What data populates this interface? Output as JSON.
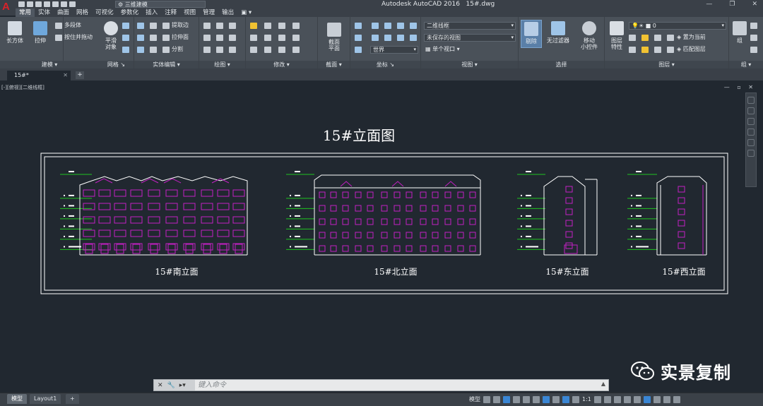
{
  "app": {
    "logo_letter": "A",
    "title": "Autodesk AutoCAD 2016",
    "filename": "15#.dwg",
    "workspace": "三维建模"
  },
  "window_controls": [
    "—",
    "❐",
    "✕"
  ],
  "ribbon_tabs": [
    "常用",
    "实体",
    "曲面",
    "网格",
    "可视化",
    "参数化",
    "插入",
    "注释",
    "视图",
    "管理",
    "输出"
  ],
  "ribbon_active_tab": 0,
  "panels": {
    "modeling": {
      "label": "建模",
      "box_label": "长方体",
      "extrude_label": "拉伸",
      "polysolid_label": "多段体",
      "presspull_label": "按住并拖动"
    },
    "mesh": {
      "label": "网格",
      "smooth_label_1": "平滑",
      "smooth_label_2": "对象"
    },
    "solid_edit": {
      "label": "实体编辑",
      "extract_edges": "提取边",
      "extrude_faces": "拉伸面",
      "separate": "分割"
    },
    "draw": {
      "label": "绘图"
    },
    "modify": {
      "label": "修改"
    },
    "section": {
      "label": "截面",
      "section_plane_1": "截面",
      "section_plane_2": "平面"
    },
    "coordinates": {
      "label": "坐标",
      "world": "世界"
    },
    "view": {
      "label": "视图",
      "visual_style": "二维线框",
      "saved_view": "未保存的视图",
      "viewport": "单个视口"
    },
    "selection": {
      "label": "选择",
      "culling": "剔除",
      "no_filter": "无过滤器",
      "gizmo_1": "移动",
      "gizmo_2": "小控件"
    },
    "layers": {
      "label": "图层",
      "layer_props_1": "图层",
      "layer_props_2": "特性",
      "current_layer": "0",
      "set_current": "置为当前",
      "match_layer": "匹配图层"
    },
    "groups": {
      "label": "组",
      "group": "组"
    }
  },
  "document_tab": {
    "name": "15#*",
    "close": "✕",
    "new": "+"
  },
  "viewport": {
    "label": "[-][俯视][二维线框]",
    "controls": "— ▫ ✕"
  },
  "drawing": {
    "title": "15#立面图",
    "elevations": [
      {
        "label": "15#南立面"
      },
      {
        "label": "15#北立面"
      },
      {
        "label": "15#东立面"
      },
      {
        "label": "15#西立面"
      }
    ],
    "colors": {
      "background": "#212830",
      "outline": "#ffffff",
      "windows": "#c31fc3",
      "levels": "#1fc41f",
      "title": "#ffffff"
    }
  },
  "watermark": {
    "text": "实景复制"
  },
  "command": {
    "placeholder": "键入命令"
  },
  "layout_tabs": [
    "模型",
    "Layout1"
  ],
  "layout_active": 0,
  "layout_new": "+",
  "status": {
    "model_label": "模型",
    "scale": "1:1"
  }
}
